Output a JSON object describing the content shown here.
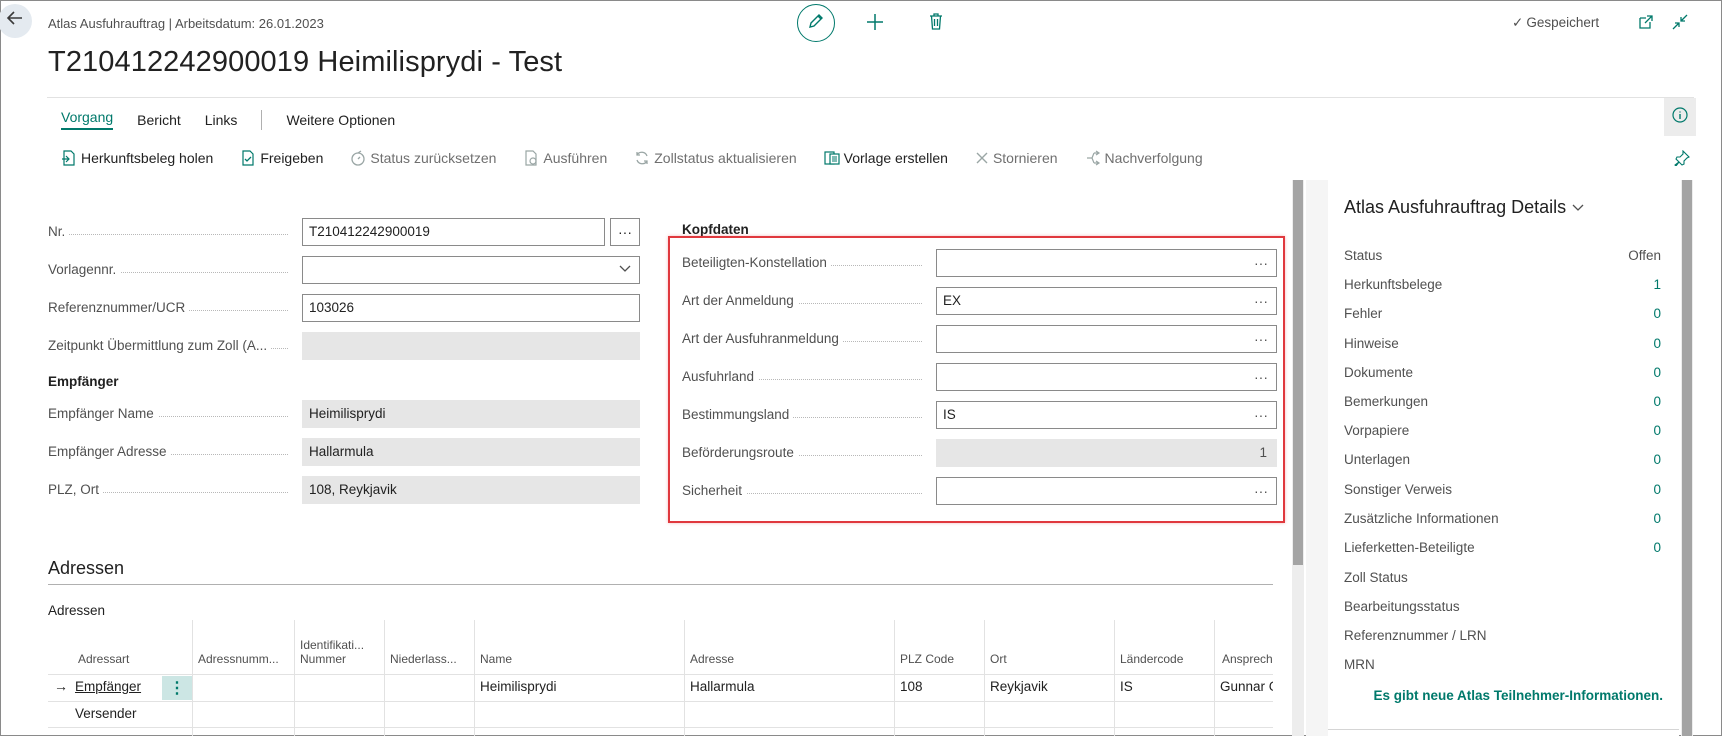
{
  "header": {
    "breadcrumb": "Atlas Ausfuhrauftrag | Arbeitsdatum: 26.01.2023",
    "title": "T210412242900019 Heimilisprydi - Test",
    "saved_label": "Gespeichert"
  },
  "tabs": [
    "Vorgang",
    "Bericht",
    "Links",
    "Weitere Optionen"
  ],
  "actions": [
    "Herkunftsbeleg holen",
    "Freigeben",
    "Status zurücksetzen",
    "Ausführen",
    "Zollstatus aktualisieren",
    "Vorlage erstellen",
    "Stornieren",
    "Nachverfolgung"
  ],
  "general": {
    "nr_label": "Nr.",
    "nr_value": "T210412242900019",
    "vorlage_label": "Vorlagennr.",
    "vorlage_value": "",
    "ref_label": "Referenznummer/UCR",
    "ref_value": "103026",
    "zeitpunkt_label": "Zeitpunkt Übermittlung zum Zoll (A...",
    "zeitpunkt_value": ""
  },
  "empfaenger": {
    "heading": "Empfänger",
    "name_label": "Empfänger Name",
    "name_value": "Heimilisprydi",
    "adresse_label": "Empfänger Adresse",
    "adresse_value": "Hallarmula",
    "plz_label": "PLZ, Ort",
    "plz_value": "108,  Reykjavik"
  },
  "kopfdaten": {
    "heading": "Kopfdaten",
    "beteiligten_label": "Beteiligten-Konstellation",
    "beteiligten_value": "",
    "anmeldung_label": "Art der Anmeldung",
    "anmeldung_value": "EX",
    "ausfuhranmeldung_label": "Art der Ausfuhranmeldung",
    "ausfuhranmeldung_value": "",
    "ausfuhrland_label": "Ausfuhrland",
    "ausfuhrland_value": "",
    "bestimmungsland_label": "Bestimmungsland",
    "bestimmungsland_value": "IS",
    "route_label": "Beförderungsroute",
    "route_value": "1",
    "sicherheit_label": "Sicherheit",
    "sicherheit_value": ""
  },
  "factbox": {
    "title": "Atlas Ausfuhrauftrag Details",
    "rows": [
      {
        "label": "Status",
        "value": "Offen"
      },
      {
        "label": "Herkunftsbelege",
        "value": "1"
      },
      {
        "label": "Fehler",
        "value": "0"
      },
      {
        "label": "Hinweise",
        "value": "0"
      },
      {
        "label": "Dokumente",
        "value": "0"
      },
      {
        "label": "Bemerkungen",
        "value": "0"
      },
      {
        "label": "Vorpapiere",
        "value": "0"
      },
      {
        "label": "Unterlagen",
        "value": "0"
      },
      {
        "label": "Sonstiger Verweis",
        "value": "0"
      },
      {
        "label": "Zusätzliche Informationen",
        "value": "0"
      },
      {
        "label": "Lieferketten-Beteiligte",
        "value": "0"
      },
      {
        "label": "Zoll Status",
        "value": ""
      },
      {
        "label": "Bearbeitungsstatus",
        "value": ""
      },
      {
        "label": "Referenznummer / LRN",
        "value": ""
      },
      {
        "label": "MRN",
        "value": ""
      }
    ],
    "notice": "Es gibt neue Atlas Teilnehmer-Informationen."
  },
  "adressen": {
    "title": "Adressen",
    "subtitle": "Adressen",
    "columns": {
      "adressart": "Adressart",
      "adressnummer": "Adressnumm...",
      "identifikation_1": "Identifikati...",
      "identifikation_2": "Nummer",
      "niederlassung": "Niederlass...",
      "name": "Name",
      "adresse": "Adresse",
      "plz": "PLZ Code",
      "ort": "Ort",
      "laendercode": "Ländercode",
      "ansprech": "Ansprech"
    },
    "rows": [
      {
        "adressart": "Empfänger",
        "name": "Heimilisprydi",
        "adresse": "Hallarmula",
        "plz": "108",
        "ort": "Reykjavik",
        "laendercode": "IS",
        "ansprech": "Gunnar G"
      },
      {
        "adressart": "Versender"
      }
    ]
  }
}
